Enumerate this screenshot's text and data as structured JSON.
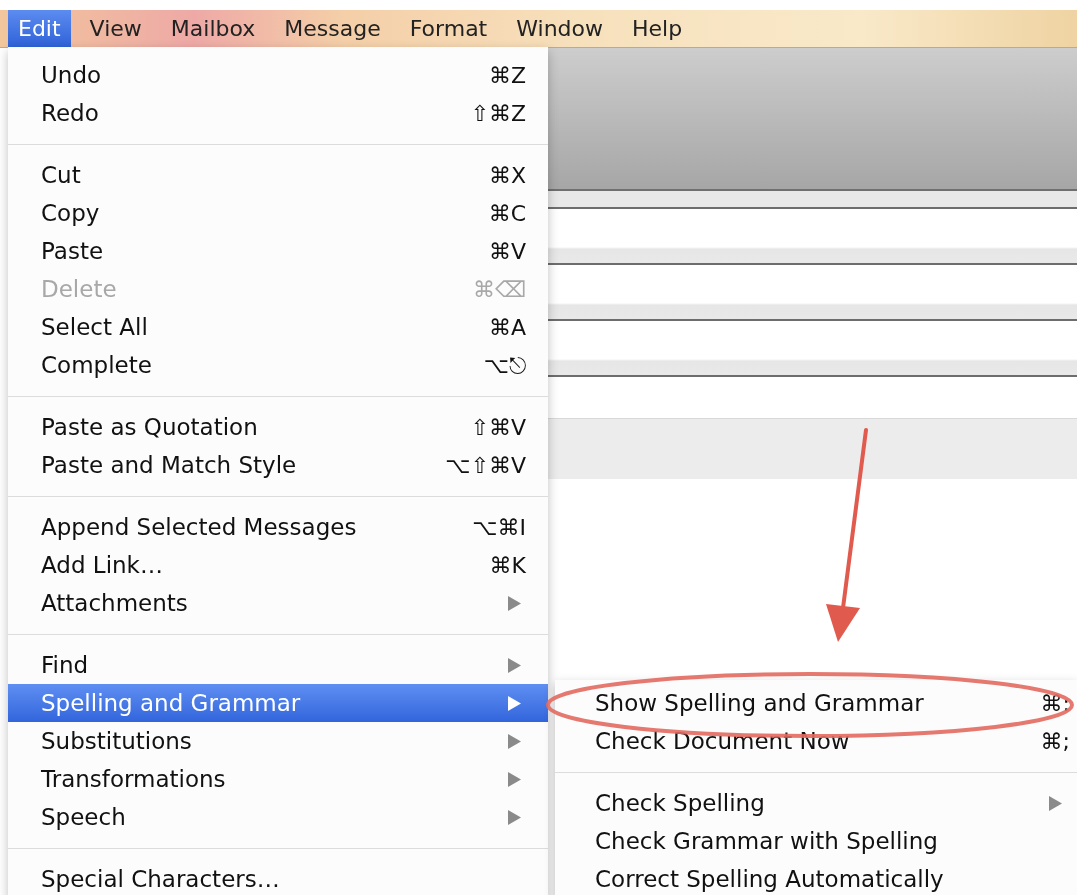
{
  "menu_bar": {
    "items": [
      {
        "label": "Edit",
        "selected": true
      },
      {
        "label": "View",
        "selected": false
      },
      {
        "label": "Mailbox",
        "selected": false
      },
      {
        "label": "Message",
        "selected": false
      },
      {
        "label": "Format",
        "selected": false
      },
      {
        "label": "Window",
        "selected": false
      },
      {
        "label": "Help",
        "selected": false
      }
    ]
  },
  "edit_menu": {
    "items": [
      {
        "kind": "item",
        "label": "Undo",
        "shortcut": "⌘Z",
        "disabled": false,
        "selected": false,
        "submenu": false
      },
      {
        "kind": "item",
        "label": "Redo",
        "shortcut": "⇧⌘Z",
        "disabled": false,
        "selected": false,
        "submenu": false
      },
      {
        "kind": "separator"
      },
      {
        "kind": "item",
        "label": "Cut",
        "shortcut": "⌘X",
        "disabled": false,
        "selected": false,
        "submenu": false
      },
      {
        "kind": "item",
        "label": "Copy",
        "shortcut": "⌘C",
        "disabled": false,
        "selected": false,
        "submenu": false
      },
      {
        "kind": "item",
        "label": "Paste",
        "shortcut": "⌘V",
        "disabled": false,
        "selected": false,
        "submenu": false
      },
      {
        "kind": "item",
        "label": "Delete",
        "shortcut": "⌘⌫",
        "disabled": true,
        "selected": false,
        "submenu": false
      },
      {
        "kind": "item",
        "label": "Select All",
        "shortcut": "⌘A",
        "disabled": false,
        "selected": false,
        "submenu": false
      },
      {
        "kind": "item",
        "label": "Complete",
        "shortcut": "⌥⎋",
        "disabled": false,
        "selected": false,
        "submenu": false
      },
      {
        "kind": "separator"
      },
      {
        "kind": "item",
        "label": "Paste as Quotation",
        "shortcut": "⇧⌘V",
        "disabled": false,
        "selected": false,
        "submenu": false
      },
      {
        "kind": "item",
        "label": "Paste and Match Style",
        "shortcut": "⌥⇧⌘V",
        "disabled": false,
        "selected": false,
        "submenu": false
      },
      {
        "kind": "separator"
      },
      {
        "kind": "item",
        "label": "Append Selected Messages",
        "shortcut": "⌥⌘I",
        "disabled": false,
        "selected": false,
        "submenu": false
      },
      {
        "kind": "item",
        "label": "Add Link…",
        "shortcut": "⌘K",
        "disabled": false,
        "selected": false,
        "submenu": false
      },
      {
        "kind": "item",
        "label": "Attachments",
        "disabled": false,
        "selected": false,
        "submenu": true
      },
      {
        "kind": "separator"
      },
      {
        "kind": "item",
        "label": "Find",
        "disabled": false,
        "selected": false,
        "submenu": true
      },
      {
        "kind": "item",
        "label": "Spelling and Grammar",
        "disabled": false,
        "selected": true,
        "submenu": true
      },
      {
        "kind": "item",
        "label": "Substitutions",
        "disabled": false,
        "selected": false,
        "submenu": true
      },
      {
        "kind": "item",
        "label": "Transformations",
        "disabled": false,
        "selected": false,
        "submenu": true
      },
      {
        "kind": "item",
        "label": "Speech",
        "disabled": false,
        "selected": false,
        "submenu": true
      },
      {
        "kind": "separator"
      },
      {
        "kind": "item",
        "label": "Special Characters…",
        "disabled": false,
        "selected": false,
        "submenu": false
      }
    ]
  },
  "spelling_submenu": {
    "items": [
      {
        "kind": "item",
        "label": "Show Spelling and Grammar",
        "shortcut": "⌘:",
        "disabled": false,
        "selected": false,
        "submenu": false
      },
      {
        "kind": "item",
        "label": "Check Document Now",
        "shortcut": "⌘;",
        "disabled": false,
        "selected": false,
        "submenu": false
      },
      {
        "kind": "separator"
      },
      {
        "kind": "item",
        "label": "Check Spelling",
        "disabled": false,
        "selected": false,
        "submenu": true
      },
      {
        "kind": "item",
        "label": "Check Grammar with Spelling",
        "disabled": false,
        "selected": false,
        "submenu": false
      },
      {
        "kind": "item",
        "label": "Correct Spelling Automatically",
        "disabled": false,
        "selected": false,
        "submenu": false
      }
    ]
  }
}
